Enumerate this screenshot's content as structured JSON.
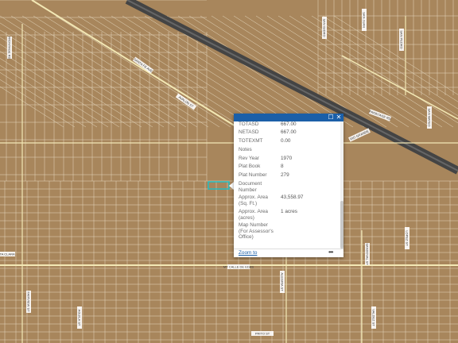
{
  "map": {
    "colors": {
      "ground": "#a8865c",
      "parcel_line": "#e6d9c0",
      "road": "#f3e8b5",
      "highway": "#444444",
      "highlight": "#19c0c8",
      "label_box": "#ffffff"
    },
    "street_labels": [
      "FRONTAGE RD",
      "SANTA FE AVE",
      "SAN ISIDRO",
      "SAN JUAN",
      "SAN PEDRO",
      "FRONTAGE RD",
      "RIO GRANDE",
      "AVALON ST",
      "SAN MATEO",
      "MT CALLE DE EDAS",
      "FAIRVIEW ST",
      "AGUILA ST",
      "ALEGRIA ST",
      "PRITO ST",
      "SANDOVAL ST",
      "LOPEZ ST",
      "VALDEZ ST",
      "SANTA CLARA",
      "ALBERT ST"
    ]
  },
  "popup": {
    "close_label": "✕",
    "maximize_label": "☐",
    "fields": [
      {
        "label": "TOTASD",
        "value": "667.00"
      },
      {
        "label": "NETASD",
        "value": "667.00"
      },
      {
        "label": "TOTEXMT",
        "value": "0.00"
      },
      {
        "label": "Notes",
        "value": ""
      },
      {
        "label": "Rev Year",
        "value": "1970"
      },
      {
        "label": "Plat Book",
        "value": "8"
      },
      {
        "label": "Plat Number",
        "value": "279"
      },
      {
        "label": "Document Number",
        "value": ""
      },
      {
        "label": "Approx. Area (Sq. Ft.)",
        "value": "43,558.97"
      },
      {
        "label": "Approx. Area (acres)",
        "value": "1 acres"
      },
      {
        "label": "Map Number (For Assessor's Office)",
        "value": ""
      }
    ],
    "zoom_label": "Zoom to",
    "more_label": "•••"
  }
}
